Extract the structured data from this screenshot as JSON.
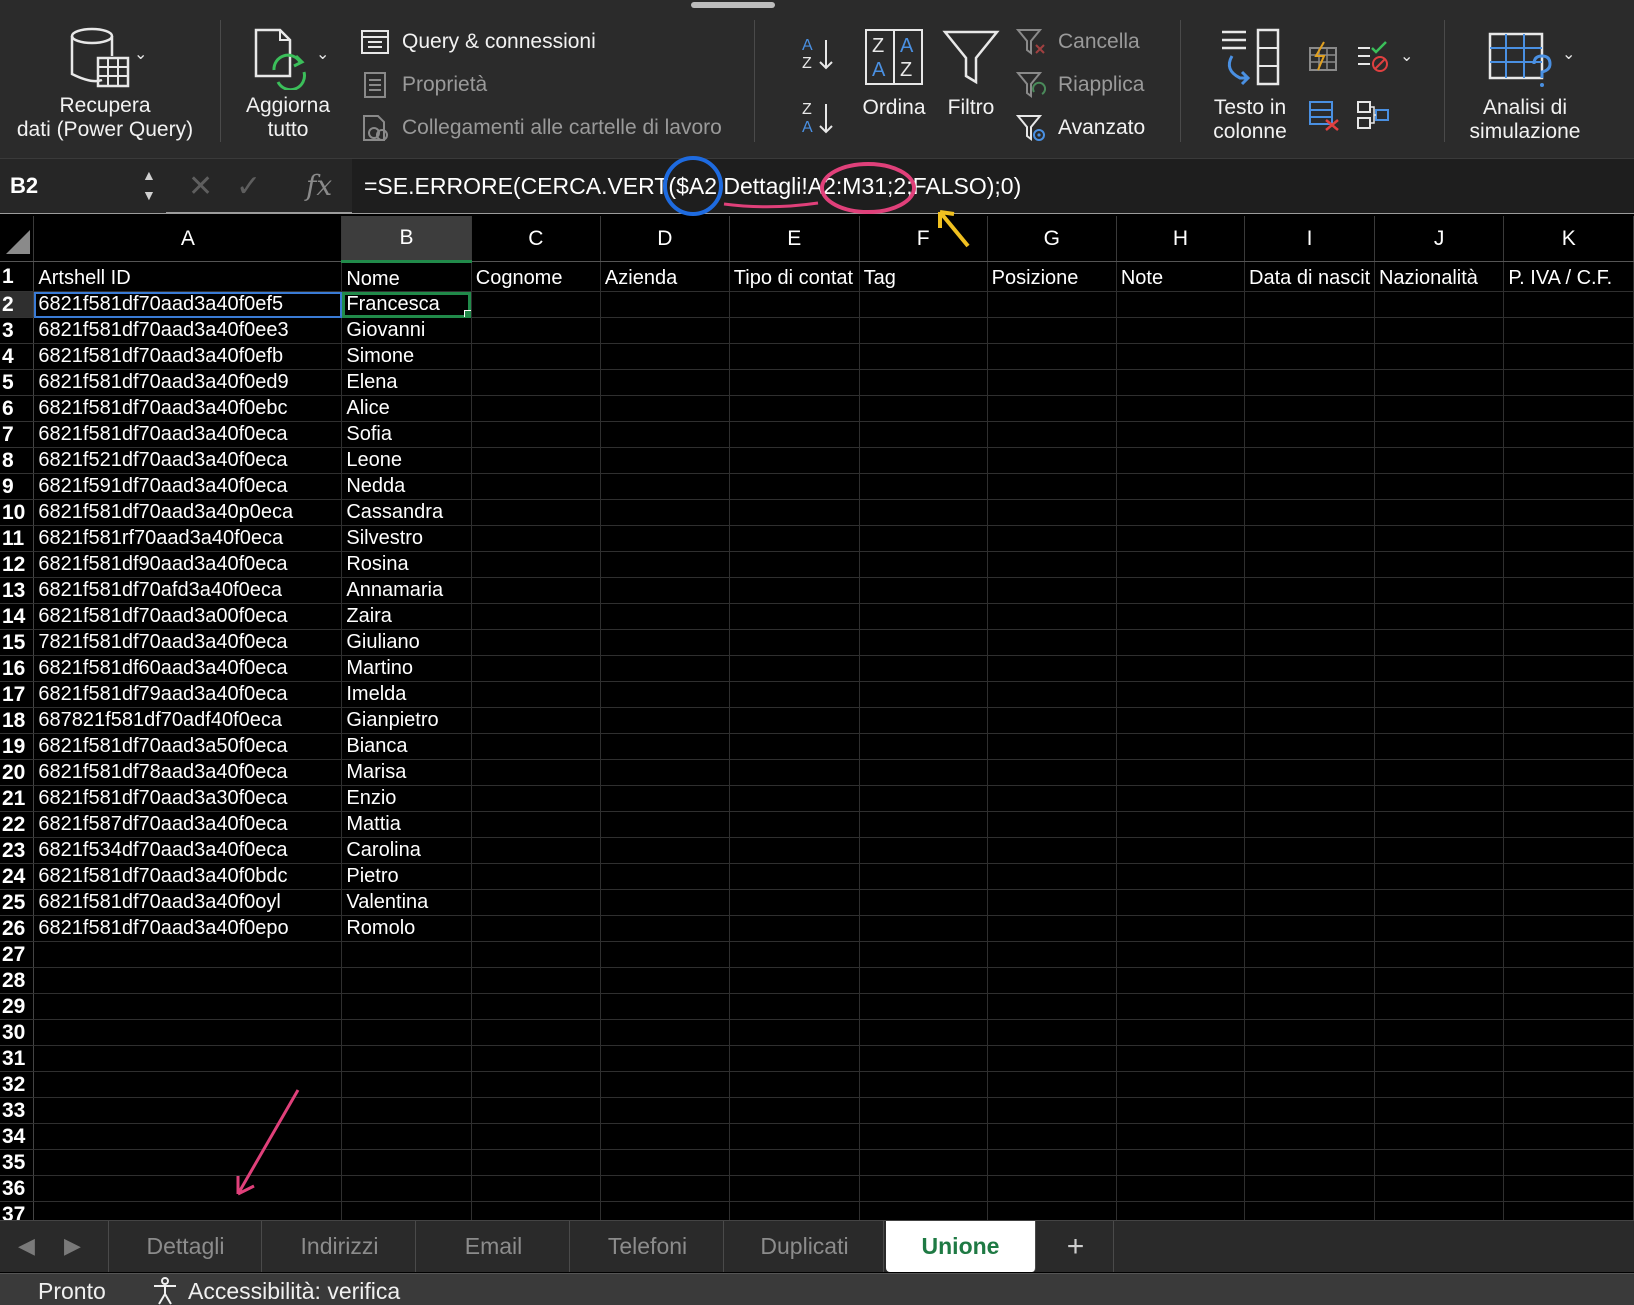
{
  "ribbon": {
    "get_data": "Recupera\ndati (Power Query)",
    "refresh_all": "Aggiorna\ntutto",
    "queries": "Query & connessioni",
    "properties": "Proprietà",
    "workbook_links": "Collegamenti alle cartelle di lavoro",
    "sort_az": "A\nZ",
    "sort_za": "Z\nA",
    "sort": "Ordina",
    "filter": "Filtro",
    "clear": "Cancella",
    "reapply": "Riapplica",
    "advanced": "Avanzato",
    "text_to_columns": "Testo in\ncolonne",
    "what_if": "Analisi di\nsimulazione"
  },
  "formula_bar": {
    "name_box": "B2",
    "fx": "fx",
    "formula_prefix": "=SE.ERRORE(CERCA.VERT(",
    "formula_ref": "$A2",
    "formula_sep": ";",
    "formula_sheet": "Dettagli",
    "formula_bang": "!",
    "formula_range": "A2:M31",
    "formula_suffix": ";2;FALSO);0)"
  },
  "columns": [
    "A",
    "B",
    "C",
    "D",
    "E",
    "F",
    "G",
    "H",
    "I",
    "J",
    "K"
  ],
  "headers": [
    "Artshell ID",
    "Nome",
    "Cognome",
    "Azienda",
    "Tipo di contat",
    "Tag",
    "Posizione",
    "Note",
    "Data di nascit",
    "Nazionalità",
    "P. IVA / C.F."
  ],
  "rows": [
    [
      "6821f581df70aad3a40f0ef5",
      "Francesca"
    ],
    [
      "6821f581df70aad3a40f0ee3",
      "Giovanni"
    ],
    [
      "6821f581df70aad3a40f0efb",
      "Simone"
    ],
    [
      "6821f581df70aad3a40f0ed9",
      "Elena"
    ],
    [
      "6821f581df70aad3a40f0ebc",
      "Alice"
    ],
    [
      "6821f581df70aad3a40f0eca",
      "Sofia"
    ],
    [
      "6821f521df70aad3a40f0eca",
      "Leone"
    ],
    [
      "6821f591df70aad3a40f0eca",
      "Nedda"
    ],
    [
      "6821f581df70aad3a40p0eca",
      "Cassandra"
    ],
    [
      "6821f581rf70aad3a40f0eca",
      "Silvestro"
    ],
    [
      "6821f581df90aad3a40f0eca",
      "Rosina"
    ],
    [
      "6821f581df70afd3a40f0eca",
      "Annamaria"
    ],
    [
      "6821f581df70aad3a00f0eca",
      "Zaira"
    ],
    [
      "7821f581df70aad3a40f0eca",
      "Giuliano"
    ],
    [
      "6821f581df60aad3a40f0eca",
      "Martino"
    ],
    [
      "6821f581df79aad3a40f0eca",
      "Imelda"
    ],
    [
      "687821f581df70adf40f0eca",
      "Gianpietro"
    ],
    [
      "6821f581df70aad3a50f0eca",
      "Bianca"
    ],
    [
      "6821f581df78aad3a40f0eca",
      "Marisa"
    ],
    [
      "6821f581df70aad3a30f0eca",
      "Enzio"
    ],
    [
      "6821f587df70aad3a40f0eca",
      "Mattia"
    ],
    [
      "6821f534df70aad3a40f0eca",
      "Carolina"
    ],
    [
      "6821f581df70aad3a40f0bdc",
      "Pietro"
    ],
    [
      "6821f581df70aad3a40f0oyl",
      "Valentina"
    ],
    [
      "6821f581df70aad3a40f0epo",
      "Romolo"
    ]
  ],
  "row_numbers": [
    "1",
    "2",
    "3",
    "4",
    "5",
    "6",
    "7",
    "8",
    "9",
    "10",
    "11",
    "12",
    "13",
    "14",
    "15",
    "16",
    "17",
    "18",
    "19",
    "20",
    "21",
    "22",
    "23",
    "24",
    "25",
    "26",
    "27",
    "28",
    "29",
    "30",
    "31",
    "32",
    "33",
    "34",
    "35",
    "36",
    "37"
  ],
  "sheet_tabs": [
    "Dettagli",
    "Indirizzi",
    "Email",
    "Telefoni",
    "Duplicati",
    "Unione"
  ],
  "active_tab": "Unione",
  "add_tab": "+",
  "status": {
    "ready": "Pronto",
    "accessibility": "Accessibilità: verifica"
  },
  "colors": {
    "accent_green": "#1f7a44",
    "annotation_blue": "#1e6be0",
    "annotation_pink": "#e0407a",
    "annotation_yellow": "#f0c020"
  }
}
